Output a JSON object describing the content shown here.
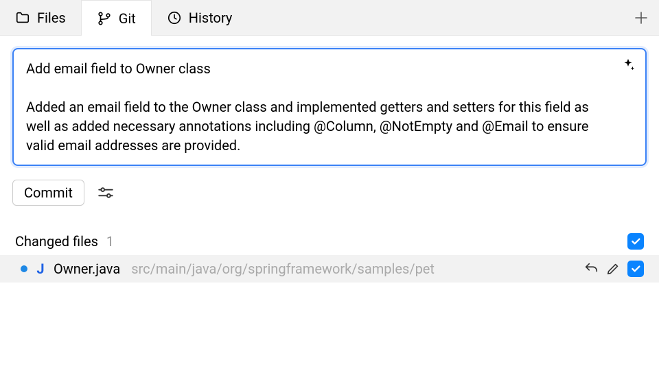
{
  "tabs": {
    "files": {
      "label": "Files"
    },
    "git": {
      "label": "Git"
    },
    "history": {
      "label": "History"
    }
  },
  "commit_message": "Add email field to Owner class\n\nAdded an email field to the Owner class and implemented getters and setters for this field as well as added necessary annotations including @Column, @NotEmpty and @Email to ensure valid email addresses are provided.",
  "commit_button": "Commit",
  "changed_files": {
    "title": "Changed files",
    "count": "1"
  },
  "files": [
    {
      "badge": "J",
      "name": "Owner.java",
      "path": "src/main/java/org/springframework/samples/pet"
    }
  ]
}
